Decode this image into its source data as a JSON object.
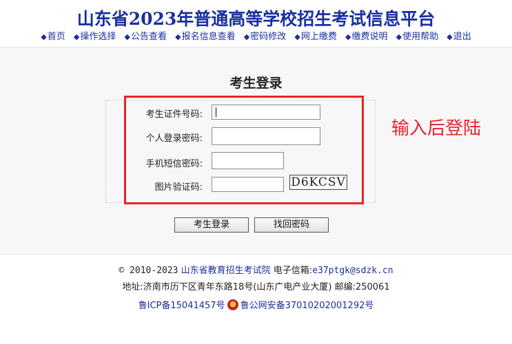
{
  "header": {
    "title": "山东省2023年普通高等学校招生考试信息平台",
    "nav": [
      {
        "label": "首页",
        "icon": "diamond-bullet-icon"
      },
      {
        "label": "操作选择",
        "icon": "diamond-bullet-icon"
      },
      {
        "label": "公告查看",
        "icon": "diamond-bullet-icon"
      },
      {
        "label": "报名信息查看",
        "icon": "diamond-bullet-icon"
      },
      {
        "label": "密码修改",
        "icon": "diamond-bullet-icon"
      },
      {
        "label": "网上缴费",
        "icon": "diamond-bullet-icon"
      },
      {
        "label": "缴费说明",
        "icon": "diamond-bullet-icon"
      },
      {
        "label": "使用帮助",
        "icon": "diamond-bullet-icon"
      },
      {
        "label": "退出",
        "icon": "diamond-bullet-icon"
      }
    ]
  },
  "login": {
    "heading": "考生登录",
    "fields": {
      "id_label": "考生证件号码:",
      "id_value": "",
      "password_label": "个人登录密码:",
      "password_value": "",
      "sms_label": "手机短信密码:",
      "sms_value": "",
      "captcha_label": "图片验证码:",
      "captcha_value": "",
      "captcha_image_text": "D6KCSV"
    },
    "annotation": "输入后登陆",
    "buttons": {
      "login": "考生登录",
      "recover": "找回密码"
    }
  },
  "footer": {
    "copyright": "© 2010-2023",
    "org": "山东省教育招生考试院",
    "email_label": "电子信箱:",
    "email": "e37ptgk@sdzk.cn",
    "address": "地址:济南市历下区青年东路18号(山东广电产业大厦) 邮编:250061",
    "icp": "鲁ICP备15041457号",
    "police": "鲁公网安备37010202001292号"
  },
  "colors": {
    "title_blue": "#1a2fa0",
    "highlight_red": "#e8232a"
  }
}
